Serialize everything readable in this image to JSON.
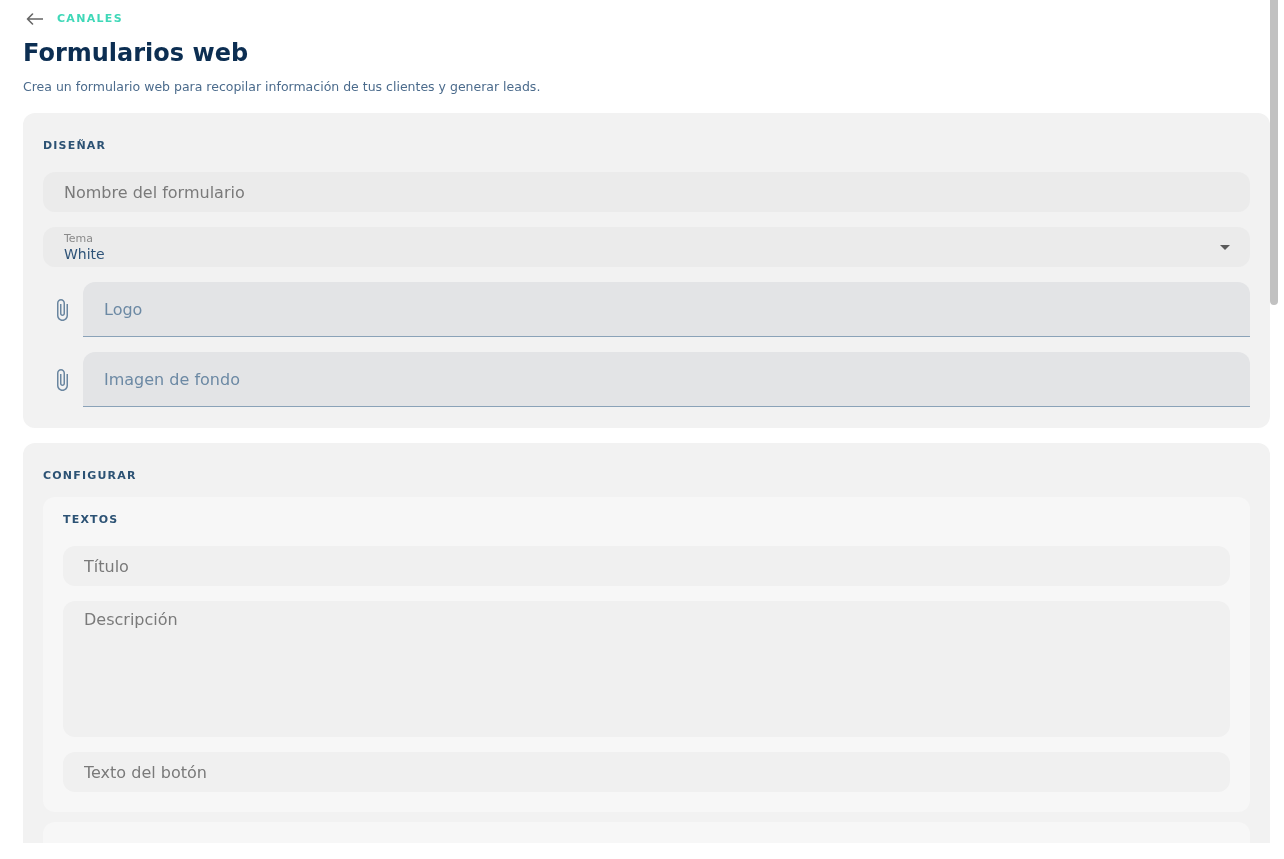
{
  "header": {
    "back_label": "CANALES",
    "title": "Formularios web",
    "subtitle": "Crea un formulario web para recopilar información de tus clientes y generar leads."
  },
  "sections": [
    {
      "title": "DISEÑAR",
      "fields": [
        {
          "kind": "text",
          "placeholder": "Nombre del formulario"
        },
        {
          "kind": "select",
          "label": "Tema",
          "value": "White"
        },
        {
          "kind": "file",
          "placeholder": "Logo"
        },
        {
          "kind": "file",
          "placeholder": "Imagen de fondo"
        }
      ]
    },
    {
      "title": "CONFIGURAR",
      "groups": [
        {
          "title": "TEXTOS",
          "fields": [
            {
              "kind": "text",
              "placeholder": "Título"
            },
            {
              "kind": "textarea",
              "placeholder": "Descripción"
            },
            {
              "kind": "text",
              "placeholder": "Texto del botón"
            }
          ]
        }
      ]
    }
  ]
}
